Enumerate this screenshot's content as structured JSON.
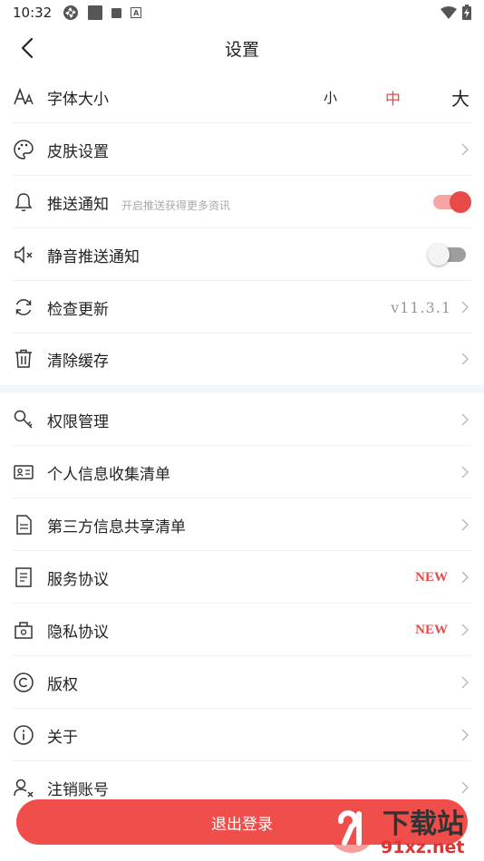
{
  "status_bar": {
    "time": "10:32"
  },
  "header": {
    "title": "设置"
  },
  "font_size": {
    "label": "字体大小",
    "small": "小",
    "medium": "中",
    "large": "大"
  },
  "rows": {
    "skin": {
      "label": "皮肤设置"
    },
    "push": {
      "label": "推送通知",
      "hint": "开启推送获得更多资讯"
    },
    "mute_push": {
      "label": "静音推送通知"
    },
    "update": {
      "label": "检查更新",
      "version": "v11.3.1"
    },
    "cache": {
      "label": "清除缓存"
    },
    "permissions": {
      "label": "权限管理"
    },
    "personal_info": {
      "label": "个人信息收集清单"
    },
    "third_party": {
      "label": "第三方信息共享清单"
    },
    "service": {
      "label": "服务协议",
      "badge": "NEW"
    },
    "privacy": {
      "label": "隐私协议",
      "badge": "NEW"
    },
    "copyright": {
      "label": "版权"
    },
    "about": {
      "label": "关于"
    },
    "deregister": {
      "label": "注销账号"
    }
  },
  "toggles": {
    "push_enabled": true,
    "mute_enabled": false
  },
  "logout": {
    "label": "退出登录"
  },
  "watermark": {
    "brand": "下载站",
    "domain": "91xz.net"
  },
  "colors": {
    "accent": "#e84a47",
    "logout_bg": "#f04e4b",
    "section_gap": "#f2f5f9"
  }
}
